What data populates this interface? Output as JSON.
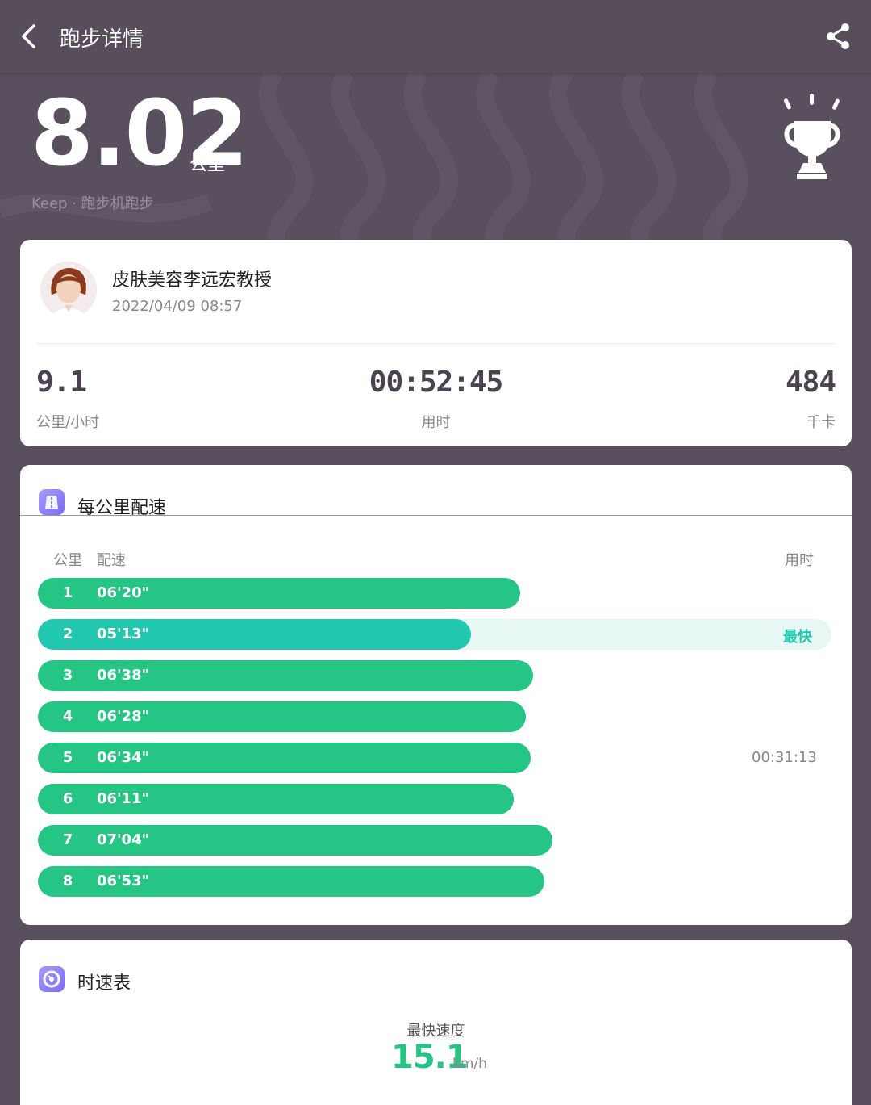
{
  "header": {
    "title": "跑步详情"
  },
  "summary": {
    "distance": "8.02",
    "distance_unit": "公里",
    "source_line": "Keep · 跑步机跑步"
  },
  "user": {
    "name": "皮肤美容李远宏教授",
    "datetime": "2022/04/09 08:57"
  },
  "stats": [
    {
      "value": "9.1",
      "label": "公里/小时"
    },
    {
      "value": "00:52:45",
      "label": "用时"
    },
    {
      "value": "484",
      "label": "千卡"
    }
  ],
  "pace_section": {
    "title": "每公里配速",
    "col_km": "公里",
    "col_pace": "配速",
    "col_time": "用时",
    "fastest_label": "最快",
    "split_time": "00:31:13",
    "rows": [
      {
        "km": "1",
        "pace": "06'20\"",
        "fraction": 0.608
      },
      {
        "km": "2",
        "pace": "05'13\"",
        "fraction": 0.546,
        "fastest": true
      },
      {
        "km": "3",
        "pace": "06'38\"",
        "fraction": 0.624
      },
      {
        "km": "4",
        "pace": "06'28\"",
        "fraction": 0.615
      },
      {
        "km": "5",
        "pace": "06'34\"",
        "fraction": 0.621
      },
      {
        "km": "6",
        "pace": "06'11\"",
        "fraction": 0.6
      },
      {
        "km": "7",
        "pace": "07'04\"",
        "fraction": 0.648
      },
      {
        "km": "8",
        "pace": "06'53\"",
        "fraction": 0.638
      }
    ]
  },
  "speed_section": {
    "title": "时速表",
    "fastest_label": "最快速度",
    "fastest_value": "15.1",
    "unit": "km/h"
  },
  "colors": {
    "background": "#5a4f5f",
    "bar_green": "#25c685",
    "bar_fastest": "#22c7b0",
    "accent_purple": "#8b7cf6"
  },
  "icons": [
    "back-arrow-icon",
    "share-icon",
    "trophy-icon",
    "pace-icon",
    "speedometer-icon"
  ]
}
